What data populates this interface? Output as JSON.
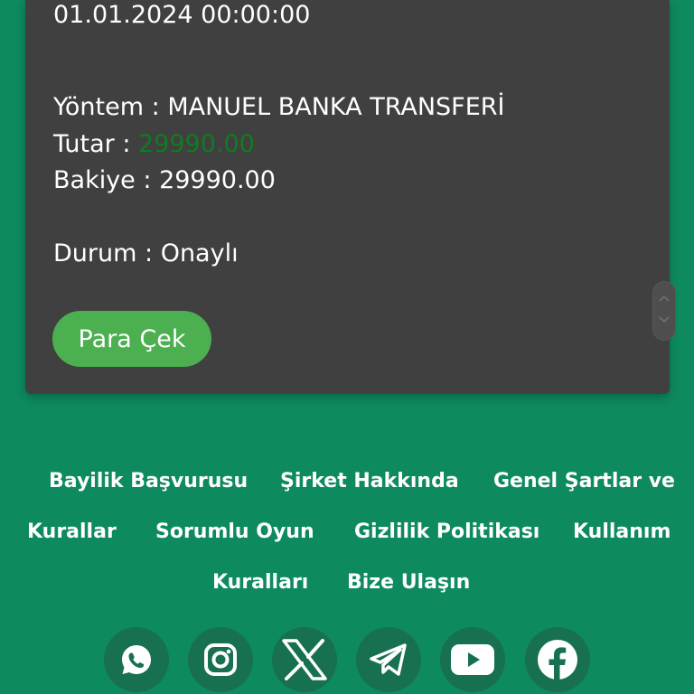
{
  "transaction": {
    "date": "01.01.2024 00:00:00",
    "method_label": "Yöntem : ",
    "method_value": "MANUEL BANKA TRANSFERİ",
    "amount_label": "Tutar : ",
    "amount_value": "29990.00",
    "balance_label": "Bakiye : ",
    "balance_value": "29990.00",
    "status_label": "Durum : ",
    "status_value": "Onaylı",
    "amount_color": "#127a21"
  },
  "withdraw_button": {
    "label": "Para Çek",
    "color": "#4caf50"
  },
  "footer": {
    "links": [
      "Bayilik Başvurusu",
      "Şirket Hakkında",
      "Genel Şartlar ve",
      "Kurallar",
      "Sorumlu Oyun",
      "Gizlilik Politikası",
      "Kullanım",
      "Kuralları",
      "Bize Ulaşın"
    ]
  },
  "social": [
    {
      "icon": "whatsapp-icon"
    },
    {
      "icon": "instagram-icon"
    },
    {
      "icon": "x-icon"
    },
    {
      "icon": "telegram-icon"
    },
    {
      "icon": "youtube-icon"
    },
    {
      "icon": "facebook-icon"
    }
  ],
  "colors": {
    "background": "#0e8a5f",
    "card": "#404040"
  }
}
